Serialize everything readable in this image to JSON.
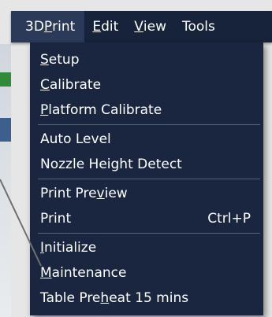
{
  "menubar": {
    "items": [
      {
        "pre": "3D ",
        "mn": "P",
        "post": "rint"
      },
      {
        "pre": "",
        "mn": "E",
        "post": "dit"
      },
      {
        "pre": "",
        "mn": "V",
        "post": "iew"
      },
      {
        "pre": "Tools",
        "mn": "",
        "post": ""
      }
    ]
  },
  "menu": {
    "setup": {
      "pre": "",
      "mn": "S",
      "post": "etup"
    },
    "calibrate": {
      "pre": "",
      "mn": "C",
      "post": "alibrate"
    },
    "platform_calibrate": {
      "pre": "",
      "mn": "P",
      "post": "latform Calibrate"
    },
    "auto_level": "Auto Level",
    "nozzle_height_detect": "Nozzle Height Detect",
    "print_preview": {
      "pre": "Print Pre",
      "mn": "v",
      "post": "iew"
    },
    "print": "Print",
    "print_shortcut": "Ctrl+P",
    "initialize": {
      "pre": "",
      "mn": "I",
      "post": "nitialize"
    },
    "maintenance": {
      "pre": "",
      "mn": "M",
      "post": "aintenance"
    },
    "table_preheat": {
      "pre": "Table Pre",
      "mn": "h",
      "post": "eat 15 mins"
    }
  },
  "colors": {
    "menu_bg": "#1a2640",
    "menubar_bg": "#17233a",
    "active_bg": "#2a3a58",
    "text": "#ffffff",
    "separator": "#56627a"
  }
}
